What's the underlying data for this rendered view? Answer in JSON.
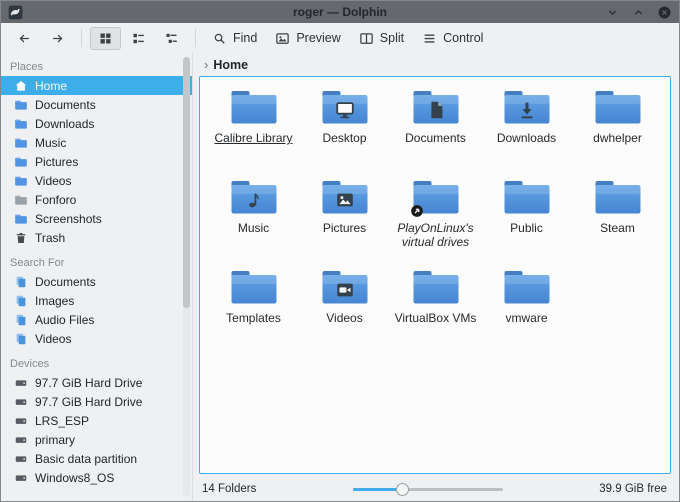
{
  "window": {
    "title": "roger — Dolphin"
  },
  "toolbar": {
    "find": "Find",
    "preview": "Preview",
    "split": "Split",
    "control": "Control"
  },
  "breadcrumb": {
    "location": "Home"
  },
  "sidebar": {
    "sections": [
      {
        "title": "Places",
        "items": [
          {
            "label": "Home",
            "selected": true
          },
          {
            "label": "Documents"
          },
          {
            "label": "Downloads"
          },
          {
            "label": "Music"
          },
          {
            "label": "Pictures"
          },
          {
            "label": "Videos"
          },
          {
            "label": "Fonforo"
          },
          {
            "label": "Screenshots"
          },
          {
            "label": "Trash"
          }
        ]
      },
      {
        "title": "Search For",
        "items": [
          {
            "label": "Documents"
          },
          {
            "label": "Images"
          },
          {
            "label": "Audio Files"
          },
          {
            "label": "Videos"
          }
        ]
      },
      {
        "title": "Devices",
        "items": [
          {
            "label": "97.7 GiB Hard Drive"
          },
          {
            "label": "97.7 GiB Hard Drive"
          },
          {
            "label": "LRS_ESP"
          },
          {
            "label": "primary"
          },
          {
            "label": "Basic data partition"
          },
          {
            "label": "Windows8_OS"
          }
        ]
      }
    ]
  },
  "files": [
    {
      "label": "Calibre Library",
      "emblem": "none",
      "selected": true
    },
    {
      "label": "Desktop",
      "emblem": "desktop"
    },
    {
      "label": "Documents",
      "emblem": "document"
    },
    {
      "label": "Downloads",
      "emblem": "download"
    },
    {
      "label": "dwhelper",
      "emblem": "none"
    },
    {
      "label": "Music",
      "emblem": "music-note"
    },
    {
      "label": "Pictures",
      "emblem": "image"
    },
    {
      "label": "PlayOnLinux's virtual drives",
      "emblem": "symlink"
    },
    {
      "label": "Public",
      "emblem": "none"
    },
    {
      "label": "Steam",
      "emblem": "none"
    },
    {
      "label": "Templates",
      "emblem": "none"
    },
    {
      "label": "Videos",
      "emblem": "video"
    },
    {
      "label": "VirtualBox VMs",
      "emblem": "none"
    },
    {
      "label": "vmware",
      "emblem": "none"
    }
  ],
  "statusbar": {
    "folders": "14 Folders",
    "free_space": "39.9 GiB free",
    "zoom_percent": 33
  },
  "colors": {
    "accent": "#3daee9",
    "folder_blue": "#5294e2"
  }
}
